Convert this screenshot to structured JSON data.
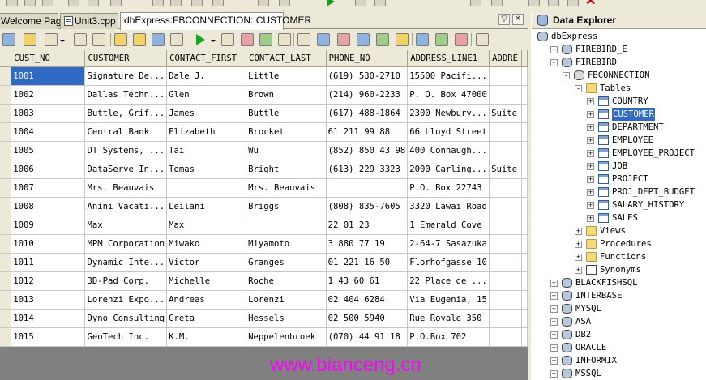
{
  "tabs": [
    {
      "label": "Welcome Page"
    },
    {
      "label": "Unit3.cpp"
    },
    {
      "label": "dbExpress:FBCONNECTION: CUSTOMER"
    }
  ],
  "grid": {
    "columns": [
      "CUST_NO",
      "CUSTOMER",
      "CONTACT_FIRST",
      "CONTACT_LAST",
      "PHONE_NO",
      "ADDRESS_LINE1",
      "ADDRE"
    ],
    "rows": [
      [
        "1001",
        "Signature De...",
        "Dale J.",
        "Little",
        "(619) 530-2710",
        "15500 Pacifi...",
        ""
      ],
      [
        "1002",
        "Dallas Techn...",
        "Glen",
        "Brown",
        "(214) 960-2233",
        "P. O. Box 47000",
        ""
      ],
      [
        "1003",
        "Buttle, Grif...",
        "James",
        "Buttle",
        "(617) 488-1864",
        "2300 Newbury...",
        "Suite"
      ],
      [
        "1004",
        "Central Bank",
        "Elizabeth",
        "Brocket",
        "61 211 99 88",
        "66 Lloyd Street",
        ""
      ],
      [
        "1005",
        "DT Systems, ...",
        "Tai",
        "Wu",
        "(852) 850 43 98",
        "400 Connaugh...",
        ""
      ],
      [
        "1006",
        "DataServe In...",
        "Tomas",
        "Bright",
        "(613) 229 3323",
        "2000 Carling...",
        "Suite"
      ],
      [
        "1007",
        "Mrs. Beauvais",
        "",
        "Mrs. Beauvais",
        "",
        "P.O. Box 22743",
        ""
      ],
      [
        "1008",
        "Anini Vacati...",
        "Leilani",
        "Briggs",
        "(808) 835-7605",
        "3320 Lawai Road",
        ""
      ],
      [
        "1009",
        "Max",
        "Max",
        "",
        "22 01 23",
        "1 Emerald Cove",
        ""
      ],
      [
        "1010",
        "MPM Corporation",
        "Miwako",
        "Miyamoto",
        "3 880 77 19",
        "2-64-7 Sasazuka",
        ""
      ],
      [
        "1011",
        "Dynamic Inte...",
        "Victor",
        "Granges",
        "01 221 16 50",
        "Florhofgasse 10",
        ""
      ],
      [
        "1012",
        "3D-Pad Corp.",
        "Michelle",
        "Roche",
        "1 43 60 61",
        "22 Place de ...",
        ""
      ],
      [
        "1013",
        "Lorenzi Expo...",
        "Andreas",
        "Lorenzi",
        "02 404 6284",
        "Via Eugenia, 15",
        ""
      ],
      [
        "1014",
        "Dyno Consulting",
        "Greta",
        "Hessels",
        "02 500 5940",
        "Rue Royale 350",
        ""
      ],
      [
        "1015",
        "GeoTech Inc.",
        "K.M.",
        "Neppelenbroek",
        "(070) 44 91 18",
        "P.O.Box 702",
        ""
      ]
    ]
  },
  "explorer": {
    "title": "Data Explorer",
    "nodes": [
      {
        "label": "dbExpress",
        "level": 0,
        "expander": "",
        "icon": "db-icon"
      },
      {
        "label": "FIREBIRD_E",
        "level": 1,
        "expander": "+",
        "icon": "db-icon"
      },
      {
        "label": "FIREBIRD",
        "level": 1,
        "expander": "-",
        "icon": "db-icon"
      },
      {
        "label": "FBCONNECTION",
        "level": 2,
        "expander": "-",
        "icon": "connection-icon"
      },
      {
        "label": "Tables",
        "level": 3,
        "expander": "-",
        "icon": "folder-icon"
      },
      {
        "label": "COUNTRY",
        "level": 4,
        "expander": "+",
        "icon": "table-icon"
      },
      {
        "label": "CUSTOMER",
        "level": 4,
        "expander": "+",
        "icon": "table-icon",
        "selected": true
      },
      {
        "label": "DEPARTMENT",
        "level": 4,
        "expander": "+",
        "icon": "table-icon"
      },
      {
        "label": "EMPLOYEE",
        "level": 4,
        "expander": "+",
        "icon": "table-icon"
      },
      {
        "label": "EMPLOYEE_PROJECT",
        "level": 4,
        "expander": "+",
        "icon": "table-icon"
      },
      {
        "label": "JOB",
        "level": 4,
        "expander": "+",
        "icon": "table-icon"
      },
      {
        "label": "PROJECT",
        "level": 4,
        "expander": "+",
        "icon": "table-icon"
      },
      {
        "label": "PROJ_DEPT_BUDGET",
        "level": 4,
        "expander": "+",
        "icon": "table-icon"
      },
      {
        "label": "SALARY_HISTORY",
        "level": 4,
        "expander": "+",
        "icon": "table-icon"
      },
      {
        "label": "SALES",
        "level": 4,
        "expander": "+",
        "icon": "table-icon"
      },
      {
        "label": "Views",
        "level": 3,
        "expander": "+",
        "icon": "folder-icon"
      },
      {
        "label": "Procedures",
        "level": 3,
        "expander": "+",
        "icon": "folder-icon"
      },
      {
        "label": "Functions",
        "level": 3,
        "expander": "+",
        "icon": "folder-icon"
      },
      {
        "label": "Synonyms",
        "level": 3,
        "expander": "+",
        "icon": "synonym-icon"
      },
      {
        "label": "BLACKFISHSQL",
        "level": 1,
        "expander": "+",
        "icon": "db-icon"
      },
      {
        "label": "INTERBASE",
        "level": 1,
        "expander": "+",
        "icon": "db-icon"
      },
      {
        "label": "MYSQL",
        "level": 1,
        "expander": "+",
        "icon": "db-icon"
      },
      {
        "label": "ASA",
        "level": 1,
        "expander": "+",
        "icon": "db-icon"
      },
      {
        "label": "DB2",
        "level": 1,
        "expander": "+",
        "icon": "db-icon"
      },
      {
        "label": "ORACLE",
        "level": 1,
        "expander": "+",
        "icon": "db-icon"
      },
      {
        "label": "INFORMIX",
        "level": 1,
        "expander": "+",
        "icon": "db-icon"
      },
      {
        "label": "MSSQL",
        "level": 1,
        "expander": "+",
        "icon": "db-icon"
      }
    ]
  },
  "watermark": "www.bianceng.cn",
  "colors": {
    "selection": "#316ac5",
    "watermark": "#ff00ff",
    "chrome": "#ece9d8"
  }
}
